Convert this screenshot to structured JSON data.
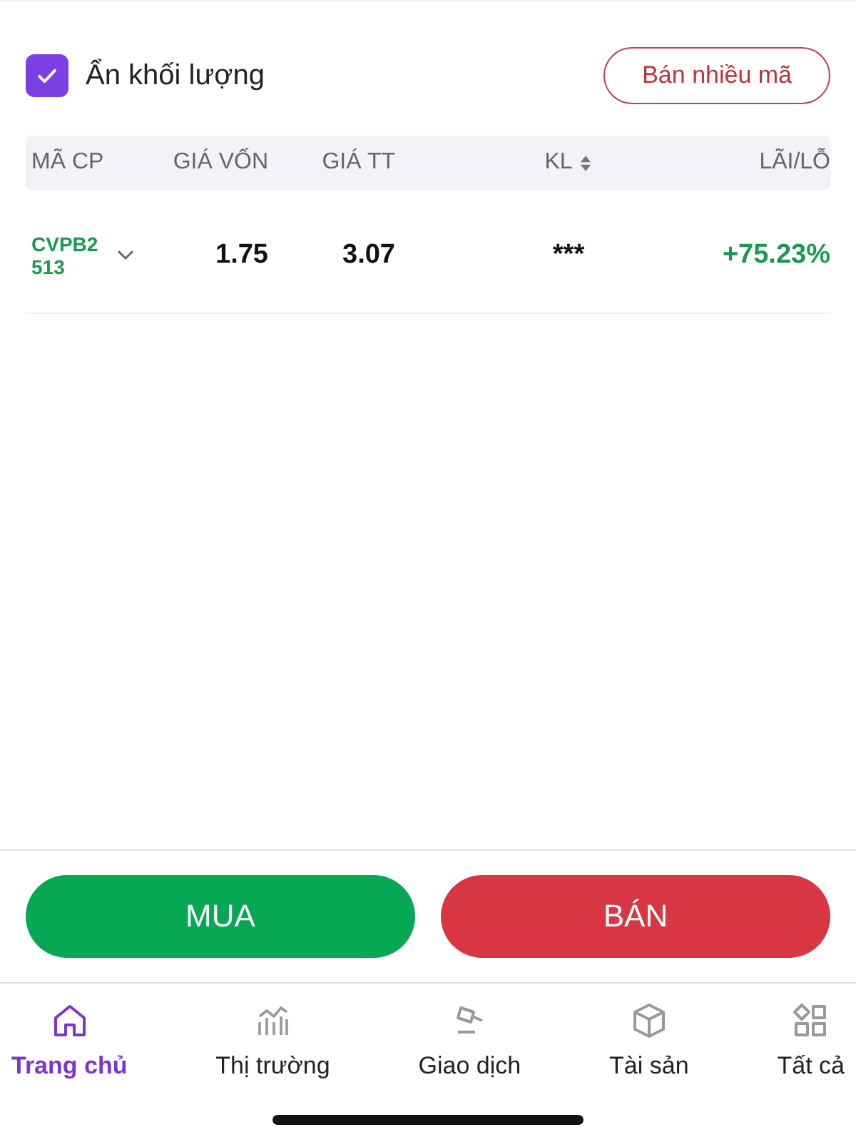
{
  "hide_volume": {
    "label": "Ẩn khối lượng",
    "checked": true
  },
  "sell_multiple_button": "Bán nhiều mã",
  "table": {
    "columns": [
      {
        "label": "MÃ CP",
        "sortable": false
      },
      {
        "label": "GIÁ VỐN",
        "sortable": false
      },
      {
        "label": "GIÁ TT",
        "sortable": false
      },
      {
        "label": "KL",
        "sortable": true
      },
      {
        "label": "LÃI/LỖ",
        "sortable": false
      }
    ],
    "rows": [
      {
        "code": "CVPB2513",
        "expanded": false,
        "cost_price": "1.75",
        "market_price": "3.07",
        "volume": "***",
        "profit_loss": "+75.23%"
      }
    ]
  },
  "actions": [
    {
      "label": "MUA",
      "kind": "buy"
    },
    {
      "label": "BÁN",
      "kind": "sell"
    }
  ],
  "nav": [
    {
      "label": "Trang chủ",
      "selected": true
    },
    {
      "label": "Thị trường",
      "selected": false
    },
    {
      "label": "Giao dịch",
      "selected": false
    },
    {
      "label": "Tài sản",
      "selected": false
    },
    {
      "label": "Tất cả",
      "selected": false
    }
  ]
}
